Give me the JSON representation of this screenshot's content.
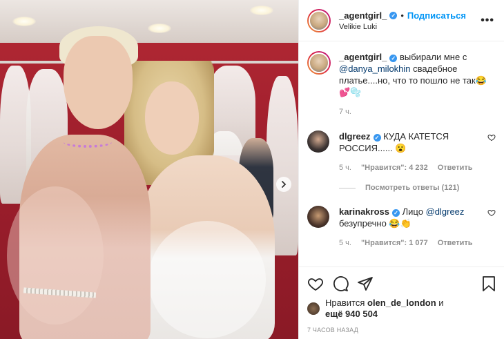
{
  "header": {
    "username": "_agentgirl_",
    "separator": "•",
    "follow_label": "Подписаться",
    "location": "Velikie Luki",
    "more_label": "•••"
  },
  "caption": {
    "username": "_agentgirl_",
    "text_before": "выбирали мне с",
    "mention": "@danya_milokhin",
    "text_after": "свадебное платье....но, что то пошло не так😂💕🫧",
    "time": "7 ч."
  },
  "comments": [
    {
      "username": "dlgreez",
      "text": "КУДА КАТЕТСЯ РОССИЯ...... 😮",
      "time": "5 ч.",
      "likes_label": "\"Нравится\": 4 232",
      "reply_label": "Ответить",
      "view_replies": "Посмотреть ответы (121)"
    },
    {
      "username": "karinakross",
      "text_before": "Лицо",
      "mention": "@dlgreez",
      "text_after": "безупречно 😂👏",
      "time": "5 ч.",
      "likes_label": "\"Нравится\": 1 077",
      "reply_label": "Ответить"
    }
  ],
  "likes": {
    "prefix": "Нравится",
    "user": "olen_de_london",
    "conj": "и",
    "more": "ещё 940 504"
  },
  "timestamp": "7 часов назад",
  "colors": {
    "accent": "#0095f6",
    "verified": "#3897f0",
    "text": "#262626",
    "muted": "#8e8e8e"
  },
  "icons": {
    "like": "heart-icon",
    "comment": "comment-icon",
    "share": "paper-plane-icon",
    "save": "bookmark-icon",
    "next": "chevron-right-icon"
  }
}
